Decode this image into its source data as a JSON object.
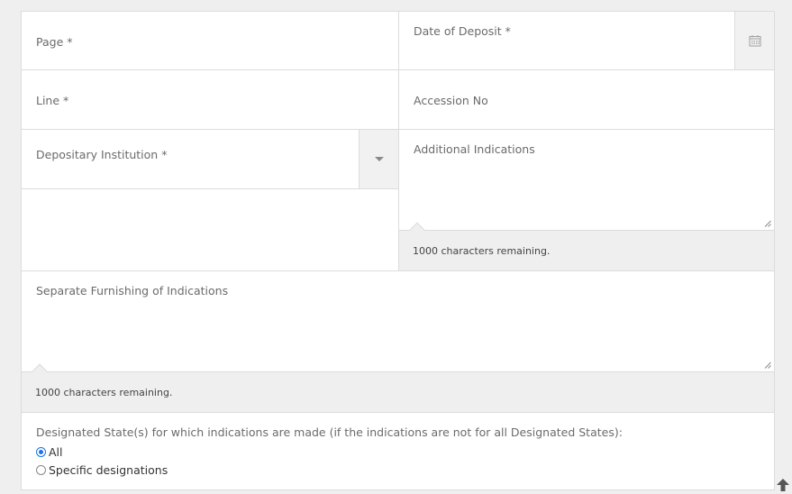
{
  "fields": {
    "page": {
      "label": "Page *"
    },
    "date_of_deposit": {
      "label": "Date of Deposit *",
      "icon": "calendar-icon"
    },
    "line": {
      "label": "Line *"
    },
    "accession_no": {
      "label": "Accession No"
    },
    "depositary_institution": {
      "label": "Depositary Institution *",
      "icon": "dropdown-arrow-icon"
    },
    "additional_indications": {
      "label": "Additional Indications",
      "counter": "1000 characters remaining."
    },
    "separate_furnishing": {
      "label": "Separate Furnishing of Indications",
      "counter": "1000 characters remaining."
    }
  },
  "designated_states": {
    "label": "Designated State(s) for which indications are made (if the indications are not for all Designated States):",
    "options": [
      {
        "label": "All",
        "selected": true
      },
      {
        "label": "Specific designations",
        "selected": false
      }
    ]
  },
  "colors": {
    "accent": "#1a73e8",
    "border": "#dcdcdc",
    "addon_bg": "#f1f1f1"
  }
}
